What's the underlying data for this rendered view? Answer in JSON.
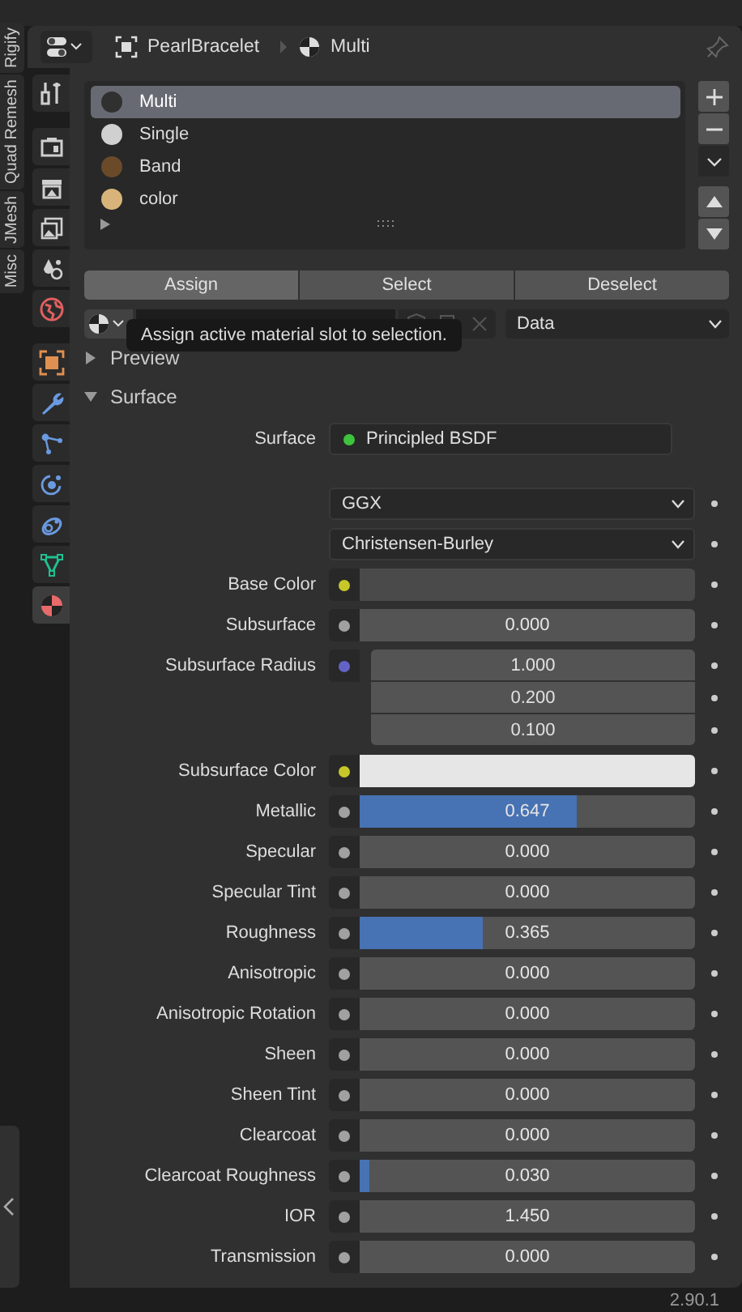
{
  "side_tabs": [
    "Rigify",
    "Quad Remesh",
    "JMesh",
    "Misc"
  ],
  "header": {
    "object": "PearlBracelet",
    "material": "Multi"
  },
  "property_tabs": [
    {
      "kind": "tool",
      "selected": false
    },
    {
      "kind": "render",
      "selected": false
    },
    {
      "kind": "output",
      "selected": false
    },
    {
      "kind": "view_layer",
      "selected": false
    },
    {
      "kind": "scene",
      "selected": false
    },
    {
      "kind": "world",
      "selected": false
    },
    {
      "kind": "object",
      "selected": false
    },
    {
      "kind": "modifier",
      "selected": false
    },
    {
      "kind": "particles",
      "selected": false
    },
    {
      "kind": "physics",
      "selected": false
    },
    {
      "kind": "constraints",
      "selected": false
    },
    {
      "kind": "data",
      "selected": false
    },
    {
      "kind": "material",
      "selected": true
    }
  ],
  "material_slots": [
    {
      "name": "Multi",
      "selected": true,
      "color": "#303030"
    },
    {
      "name": "Single",
      "selected": false,
      "color": "#d0d0d0"
    },
    {
      "name": "Band",
      "selected": false,
      "color": "#6b4a2a"
    },
    {
      "name": "color",
      "selected": false,
      "color": "#d9b47a"
    }
  ],
  "slot_buttons": [
    "Assign",
    "Select",
    "Deselect"
  ],
  "material_link": "Data",
  "tooltip": "Assign active material slot to selection.",
  "panels": [
    {
      "title": "Preview",
      "expanded": false
    },
    {
      "title": "Surface",
      "expanded": true
    }
  ],
  "surface": {
    "label": "Surface",
    "shader": "Principled BSDF"
  },
  "dropdowns": [
    "GGX",
    "Christensen-Burley"
  ],
  "inputs": [
    {
      "kind": "color",
      "label": "Base Color",
      "color": "#4a4a4a"
    },
    {
      "kind": "slider",
      "label": "Subsurface",
      "value": "0.000"
    },
    {
      "kind": "vector",
      "label": "Subsurface Radius",
      "values": [
        "1.000",
        "0.200",
        "0.100"
      ]
    },
    {
      "kind": "color",
      "label": "Subsurface Color",
      "color": "#e6e6e6"
    },
    {
      "kind": "slider",
      "label": "Metallic",
      "value": "0.647",
      "level": 0.647
    },
    {
      "kind": "slider",
      "label": "Specular",
      "value": "0.000"
    },
    {
      "kind": "slider",
      "label": "Specular Tint",
      "value": "0.000"
    },
    {
      "kind": "slider",
      "label": "Roughness",
      "value": "0.365",
      "level": 0.365
    },
    {
      "kind": "slider",
      "label": "Anisotropic",
      "value": "0.000"
    },
    {
      "kind": "slider",
      "label": "Anisotropic Rotation",
      "value": "0.000"
    },
    {
      "kind": "slider",
      "label": "Sheen",
      "value": "0.000"
    },
    {
      "kind": "slider",
      "label": "Sheen Tint",
      "value": "0.000"
    },
    {
      "kind": "slider",
      "label": "Clearcoat",
      "value": "0.000"
    },
    {
      "kind": "slider",
      "label": "Clearcoat Roughness",
      "value": "0.030",
      "level": 0.03
    },
    {
      "kind": "number",
      "label": "IOR",
      "value": "1.450"
    },
    {
      "kind": "slider",
      "label": "Transmission",
      "value": "0.000"
    }
  ],
  "version": "2.90.1"
}
